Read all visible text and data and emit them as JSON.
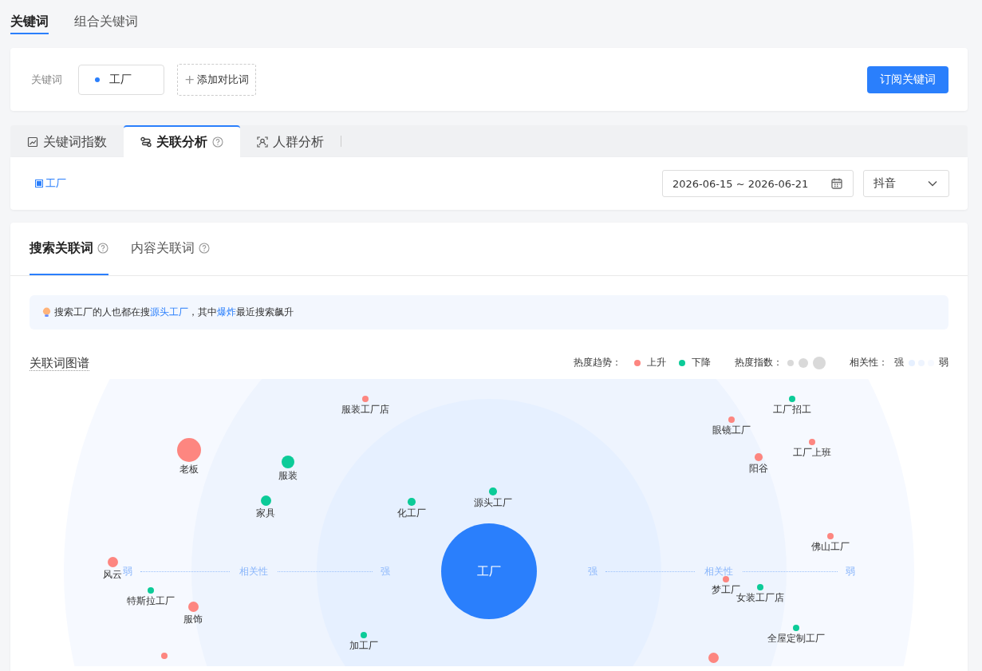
{
  "top_tabs": [
    {
      "label": "关键词",
      "selected": true
    },
    {
      "label": "组合关键词",
      "selected": false
    }
  ],
  "keyword_bar": {
    "label": "关键词",
    "keywords": [
      {
        "text": "工厂",
        "color": "#2a7ffc"
      }
    ],
    "add_icon": "+",
    "add_label": "添加对比词",
    "subscribe_button": "订阅关键词"
  },
  "analysis_tabs": [
    {
      "label": "关键词指数",
      "help": false,
      "selected": false
    },
    {
      "label": "关联分析",
      "help": true,
      "selected": true
    },
    {
      "label": "人群分析",
      "help": false,
      "selected": false
    }
  ],
  "filter": {
    "keyword_tag": {
      "text": "工厂",
      "checked": true
    },
    "date_range": "2026-06-15 ~ 2026-06-21",
    "platform": "抖音"
  },
  "sub_tabs": [
    {
      "label": "搜索关联词",
      "help": true,
      "selected": true
    },
    {
      "label": "内容关联词",
      "help": true,
      "selected": false
    }
  ],
  "tip": [
    {
      "kind": "text",
      "text": "搜索工厂的人也都在搜"
    },
    {
      "kind": "link",
      "text": "源头工厂"
    },
    {
      "kind": "text",
      "text": "，其中"
    },
    {
      "kind": "link",
      "text": "爆炸"
    },
    {
      "kind": "text",
      "text": "最近搜索飙升"
    }
  ],
  "graph": {
    "title": "关联词图谱",
    "legend": {
      "trend_label": "热度趋势：",
      "trend_items": [
        {
          "label": "上升",
          "color": "#fd8680"
        },
        {
          "label": "下降",
          "color": "#0ccb98"
        }
      ],
      "heat_label": "热度指数：",
      "relevance_label": "相关性：",
      "relevance_strong": "强",
      "relevance_weak": "弱"
    },
    "center": "工厂",
    "axis_left": [
      "弱",
      "相关性",
      "强"
    ],
    "axis_right": [
      "强",
      "相关性",
      "弱"
    ],
    "nodes": [
      {
        "label": "服装工厂店",
        "color": "#fd8680",
        "kind": "tiny"
      },
      {
        "label": "老板",
        "color": "#fd8680",
        "kind": "huge"
      },
      {
        "label": "服装",
        "color": "#0ccb98",
        "kind": "large"
      },
      {
        "label": "家具",
        "color": "#0ccb98",
        "kind": "medium"
      },
      {
        "label": "化工厂",
        "color": "#0ccb98",
        "kind": "small"
      },
      {
        "label": "源头工厂",
        "color": "#0ccb98",
        "kind": "small"
      },
      {
        "label": "工厂招工",
        "color": "#0ccb98",
        "kind": "tiny"
      },
      {
        "label": "眼镜工厂",
        "color": "#fd8680",
        "kind": "tiny"
      },
      {
        "label": "工厂上班",
        "color": "#fd8680",
        "kind": "tiny"
      },
      {
        "label": "阳谷",
        "color": "#fd8680",
        "kind": "small"
      },
      {
        "label": "佛山工厂",
        "color": "#fd8680",
        "kind": "tiny"
      },
      {
        "label": "风云",
        "color": "#fd8680",
        "kind": "medium"
      },
      {
        "label": "特斯拉工厂",
        "color": "#0ccb98",
        "kind": "tiny"
      },
      {
        "label": "服饰",
        "color": "#fd8680",
        "kind": "medium"
      },
      {
        "label": "梦工厂",
        "color": "#fd8680",
        "kind": "tiny"
      },
      {
        "label": "女装工厂店",
        "color": "#0ccb98",
        "kind": "tiny"
      },
      {
        "label": "加工厂",
        "color": "#0ccb98",
        "kind": "tiny"
      },
      {
        "label": "全屋定制工厂",
        "color": "#0ccb98",
        "kind": "tiny"
      },
      {
        "color": "#fd8680",
        "kind": "tiny"
      },
      {
        "color": "#fd8680",
        "kind": "medium"
      }
    ]
  }
}
